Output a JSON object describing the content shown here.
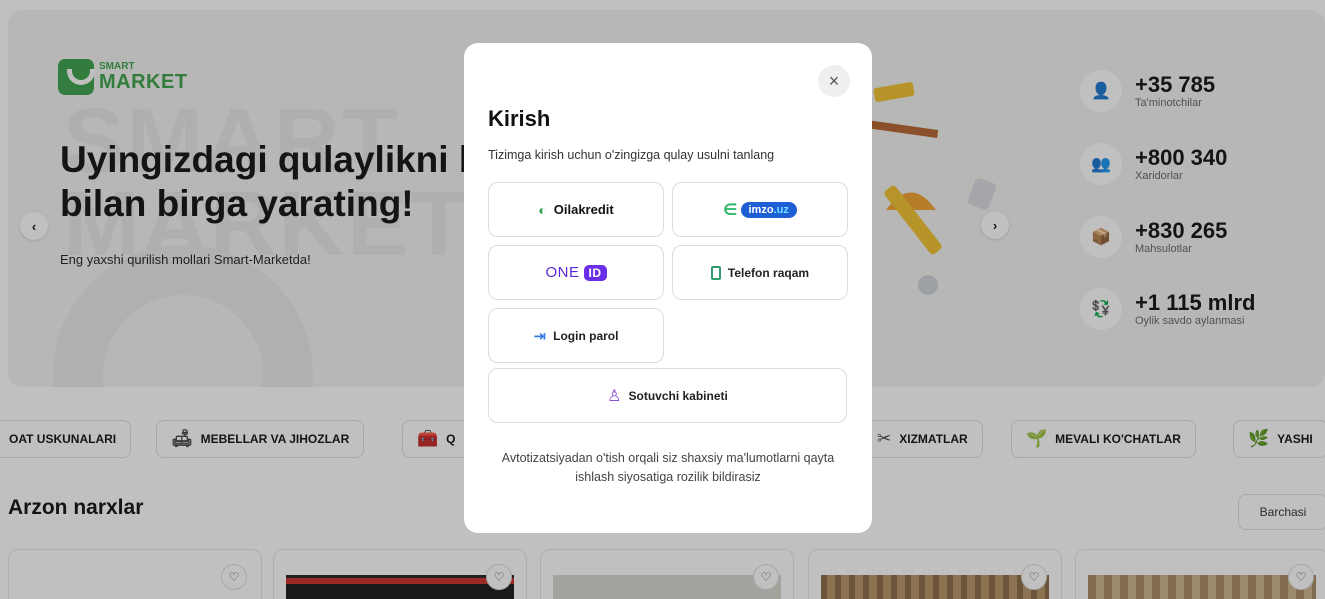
{
  "brand": {
    "small": "SMART",
    "big": "MARKET",
    "color": "#3ba34a"
  },
  "hero": {
    "watermark": "SMART\nMARKET",
    "title": "Uyingizdagi qulaylikni b\nbilan birga yarating!",
    "subtitle": "Eng yaxshi qurilish mollari Smart-Marketda!",
    "prev_icon": "chevron-left-icon",
    "next_icon": "chevron-right-icon",
    "prev_glyph": "‹",
    "next_glyph": "›"
  },
  "stats": [
    {
      "value": "+35 785",
      "label": "Ta'minotchilar",
      "icon": "supplier-icon",
      "glyph": "👤"
    },
    {
      "value": "+800 340",
      "label": "Xaridorlar",
      "icon": "buyers-icon",
      "glyph": "👥"
    },
    {
      "value": "+830 265",
      "label": "Mahsulotlar",
      "icon": "products-icon",
      "glyph": "📦"
    },
    {
      "value": "+1 115 mlrd",
      "label": "Oylik savdo aylanmasi",
      "icon": "turnover-icon",
      "glyph": "💱"
    }
  ],
  "categories": [
    {
      "label": "OAT USKUNALARI",
      "icon": ""
    },
    {
      "label": "MEBELLAR VA JIHOZLAR",
      "icon": "furniture-icon",
      "glyph": "🛋"
    },
    {
      "label": "Q",
      "icon": "tools-icon",
      "glyph": "🧰"
    },
    {
      "label": "XIZMATLAR",
      "icon": "services-icon",
      "glyph": "✂"
    },
    {
      "label": "MEVALI KO'CHATLAR",
      "icon": "plant-icon",
      "glyph": "🌱"
    },
    {
      "label": "YASHI",
      "icon": "leaf-icon",
      "glyph": "🌿"
    }
  ],
  "section": {
    "title": "Arzon narxlar",
    "all_label": "Barchasi"
  },
  "heart_glyph": "♡",
  "modal": {
    "title": "Kirish",
    "subtitle": "Tizimga kirish uchun o'zingizga qulay usulni tanlang",
    "close_glyph": "×",
    "options": {
      "oilakredit": "Oilakredit",
      "imzo_a": "imzo",
      "imzo_b": ".uz",
      "oneid_text": "ONE",
      "oneid_badge": "ID",
      "phone": "Telefon raqam",
      "login": "Login parol",
      "seller": "Sotuvchi kabineti"
    },
    "note": "Avtotizatsiyadan o'tish orqali siz shaxsiy ma'lumotlarni qayta ishlash siyosatiga rozilik bildirasiz"
  }
}
